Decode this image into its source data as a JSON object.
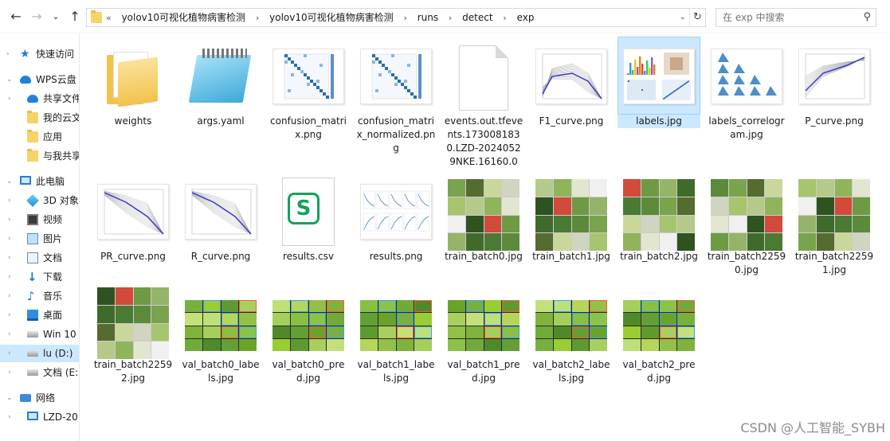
{
  "toolbar": {
    "back_icon": "←",
    "forward_icon": "→",
    "recent_icon": "⌄",
    "up_icon": "↑",
    "path_prefix": "«",
    "breadcrumbs": [
      "yolov10可视化植物病害检测",
      "yolov10可视化植物病害检测",
      "runs",
      "detect",
      "exp"
    ],
    "dropdown_icon": "⌄",
    "refresh_icon": "↻",
    "search_placeholder": "在 exp 中搜索",
    "search_icon": "⚲"
  },
  "sidebar": {
    "items": [
      {
        "label": "快速访问",
        "icon": "star-icon",
        "arrow": "›"
      },
      {
        "label": "WPS云盘",
        "icon": "cloud-icon",
        "arrow": "⌄"
      },
      {
        "label": "共享文件",
        "icon": "share-icon",
        "arrow": "›"
      },
      {
        "label": "我的云文",
        "icon": "folder-icon",
        "arrow": ""
      },
      {
        "label": "应用",
        "icon": "folder-icon",
        "arrow": ""
      },
      {
        "label": "与我共享",
        "icon": "folder-icon",
        "arrow": ""
      },
      {
        "label": "此电脑",
        "icon": "computer-icon",
        "arrow": "⌄"
      },
      {
        "label": "3D 对象",
        "icon": "cube-icon",
        "arrow": "›"
      },
      {
        "label": "视频",
        "icon": "video-icon",
        "arrow": "›"
      },
      {
        "label": "图片",
        "icon": "picture-icon",
        "arrow": "›"
      },
      {
        "label": "文档",
        "icon": "document-icon",
        "arrow": "›"
      },
      {
        "label": "下载",
        "icon": "download-icon",
        "arrow": "›"
      },
      {
        "label": "音乐",
        "icon": "music-icon",
        "arrow": "›"
      },
      {
        "label": "桌面",
        "icon": "desktop-icon",
        "arrow": "›"
      },
      {
        "label": "Win 10",
        "icon": "drive-icon",
        "arrow": "›"
      },
      {
        "label": "lu (D:)",
        "icon": "drive-icon",
        "arrow": "›"
      },
      {
        "label": "文档 (E:",
        "icon": "drive-icon",
        "arrow": "›"
      },
      {
        "label": "网络",
        "icon": "network-icon",
        "arrow": "⌄"
      },
      {
        "label": "LZD-20",
        "icon": "computer-icon",
        "arrow": "›"
      }
    ],
    "selected": "lu (D:)"
  },
  "files": [
    {
      "name": "weights",
      "kind": "folder"
    },
    {
      "name": "args.yaml",
      "kind": "notepad"
    },
    {
      "name": "confusion_matrix.png",
      "kind": "plot"
    },
    {
      "name": "confusion_matrix_normalized.png",
      "kind": "plot"
    },
    {
      "name": "events.out.tfevents.1730081830.LZD-20240529NKE.16160.0",
      "kind": "blank"
    },
    {
      "name": "F1_curve.png",
      "kind": "plot"
    },
    {
      "name": "labels.jpg",
      "kind": "plot",
      "selected": true
    },
    {
      "name": "labels_correlogram.jpg",
      "kind": "plot"
    },
    {
      "name": "P_curve.png",
      "kind": "plot"
    },
    {
      "name": "PR_curve.png",
      "kind": "plot"
    },
    {
      "name": "R_curve.png",
      "kind": "plot"
    },
    {
      "name": "results.csv",
      "kind": "csv"
    },
    {
      "name": "results.png",
      "kind": "plot"
    },
    {
      "name": "train_batch0.jpg",
      "kind": "batch"
    },
    {
      "name": "train_batch1.jpg",
      "kind": "batch"
    },
    {
      "name": "train_batch2.jpg",
      "kind": "batch"
    },
    {
      "name": "train_batch22590.jpg",
      "kind": "batch"
    },
    {
      "name": "train_batch22591.jpg",
      "kind": "batch"
    },
    {
      "name": "train_batch22592.jpg",
      "kind": "batch"
    },
    {
      "name": "val_batch0_labels.jpg",
      "kind": "val"
    },
    {
      "name": "val_batch0_pred.jpg",
      "kind": "val"
    },
    {
      "name": "val_batch1_labels.jpg",
      "kind": "val"
    },
    {
      "name": "val_batch1_pred.jpg",
      "kind": "val"
    },
    {
      "name": "val_batch2_labels.jpg",
      "kind": "val"
    },
    {
      "name": "val_batch2_pred.jpg",
      "kind": "val"
    }
  ],
  "csv_glyph": "S",
  "watermark": "CSDN @人工智能_SYBH"
}
